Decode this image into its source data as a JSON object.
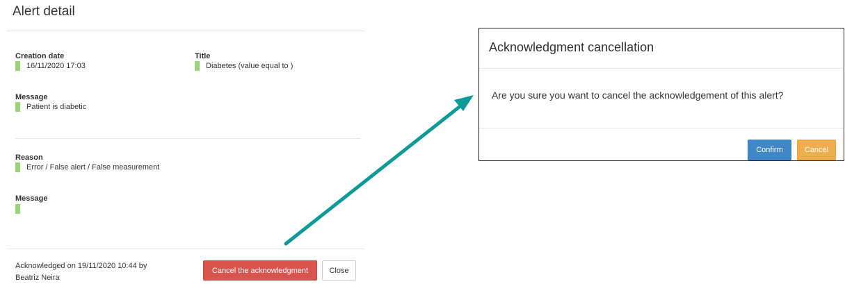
{
  "alert_detail": {
    "title": "Alert detail",
    "creation_date": {
      "label": "Creation date",
      "value": "16/11/2020 17:03"
    },
    "title_field": {
      "label": "Title",
      "value": "Diabetes (value equal to )"
    },
    "message": {
      "label": "Message",
      "value": "Patient is diabetic"
    },
    "reason": {
      "label": "Reason",
      "value": "Error / False alert / False measurement"
    },
    "message2": {
      "label": "Message",
      "value": ""
    },
    "acknowledged_line1": "Acknowledged on 19/11/2020 10:44 by",
    "acknowledged_line2": "Beatriz Neira",
    "cancel_ack_label": "Cancel the acknowledgment",
    "close_label": "Close"
  },
  "modal": {
    "title": "Acknowledgment cancellation",
    "body": "Are you sure you want to cancel the acknowledgement of this alert?",
    "confirm_label": "Confirm",
    "cancel_label": "Cancel"
  },
  "colors": {
    "marker": "#9bd27c",
    "danger": "#d9534f",
    "primary": "#3f87c8",
    "warning": "#f0ad4e",
    "arrow": "#0e9a97"
  }
}
